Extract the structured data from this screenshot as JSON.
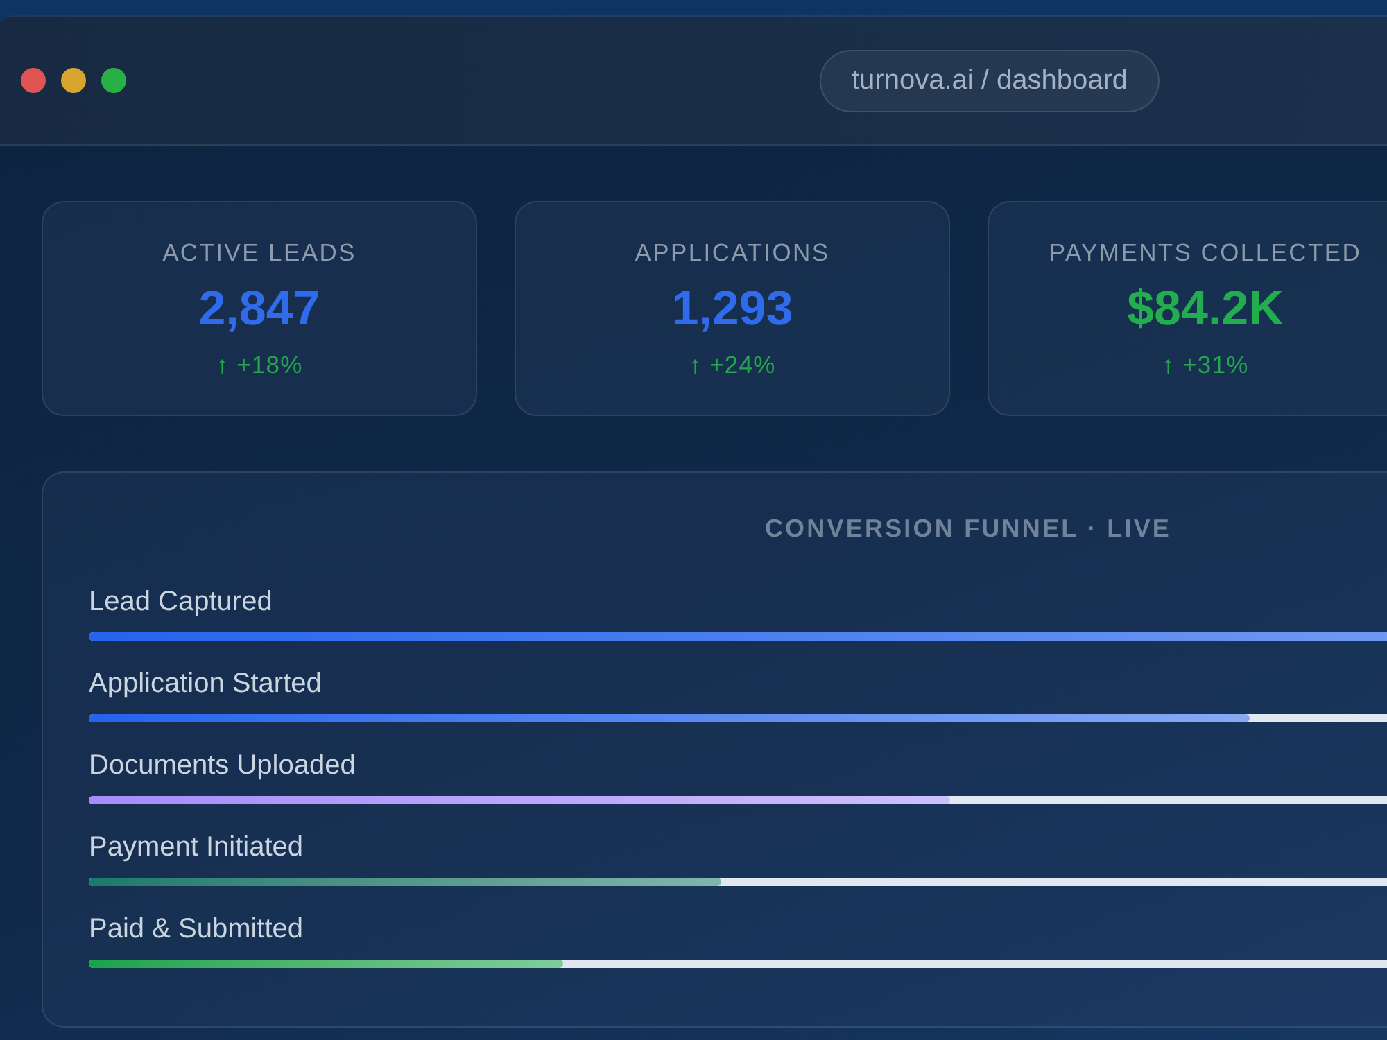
{
  "window": {
    "address": "turnova.ai / dashboard"
  },
  "stats": [
    {
      "label": "ACTIVE LEADS",
      "value": "2,847",
      "change": "↑ +18%",
      "color": "#2f6bea"
    },
    {
      "label": "APPLICATIONS",
      "value": "1,293",
      "change": "↑ +24%",
      "color": "#2f6bea"
    },
    {
      "label": "PAYMENTS COLLECTED",
      "value": "$84.2K",
      "change": "↑ +31%",
      "color": "#22ad4e"
    }
  ],
  "funnel": {
    "title": "CONVERSION FUNNEL · LIVE",
    "rows": [
      {
        "label": "Lead Captured",
        "level": 1.0,
        "color": "#2563eb"
      },
      {
        "label": "Application Started",
        "level": 0.66,
        "color": "#2563eb"
      },
      {
        "label": "Documents Uploaded",
        "level": 0.49,
        "color": "#a78bfa"
      },
      {
        "label": "Payment Initiated",
        "level": 0.36,
        "color": "#1a7a6a"
      },
      {
        "label": "Paid & Submitted",
        "level": 0.27,
        "color": "#16a34a"
      }
    ]
  }
}
